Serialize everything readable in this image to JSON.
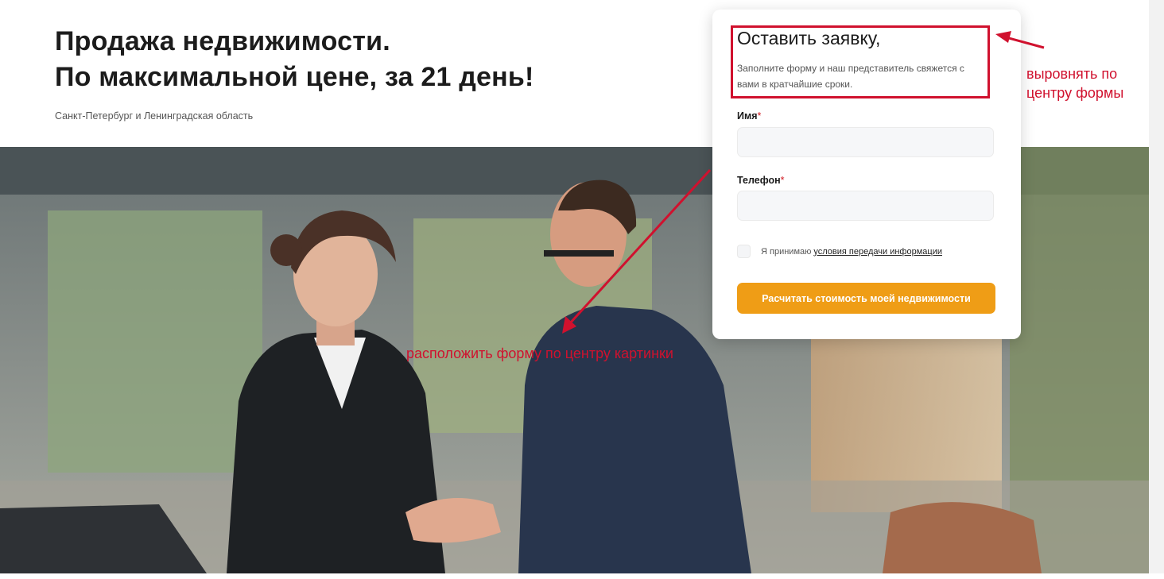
{
  "hero": {
    "headline_line1": "Продажа недвижимости.",
    "headline_line2": "По максимальной цене, за 21 день!",
    "region": "Санкт-Петербург и Ленинградская область"
  },
  "form": {
    "title": "Оставить заявку,",
    "description": "Заполните форму и наш представитель свяжется с вами в кратчайшие сроки.",
    "name_label": "Имя",
    "phone_label": "Телефон",
    "required_mark": "*",
    "name_value": "",
    "phone_value": "",
    "consent_text": "Я принимаю",
    "consent_link": "условия передачи информации",
    "submit_label": "Расчитать стоимость моей недвижимости"
  },
  "annotations": {
    "align_note": "выровнять по центру формы",
    "center_note": "расположить форму по центру картинки"
  },
  "colors": {
    "accent": "#ef9d16",
    "annotation": "#d0112e",
    "required": "#d0171f"
  }
}
